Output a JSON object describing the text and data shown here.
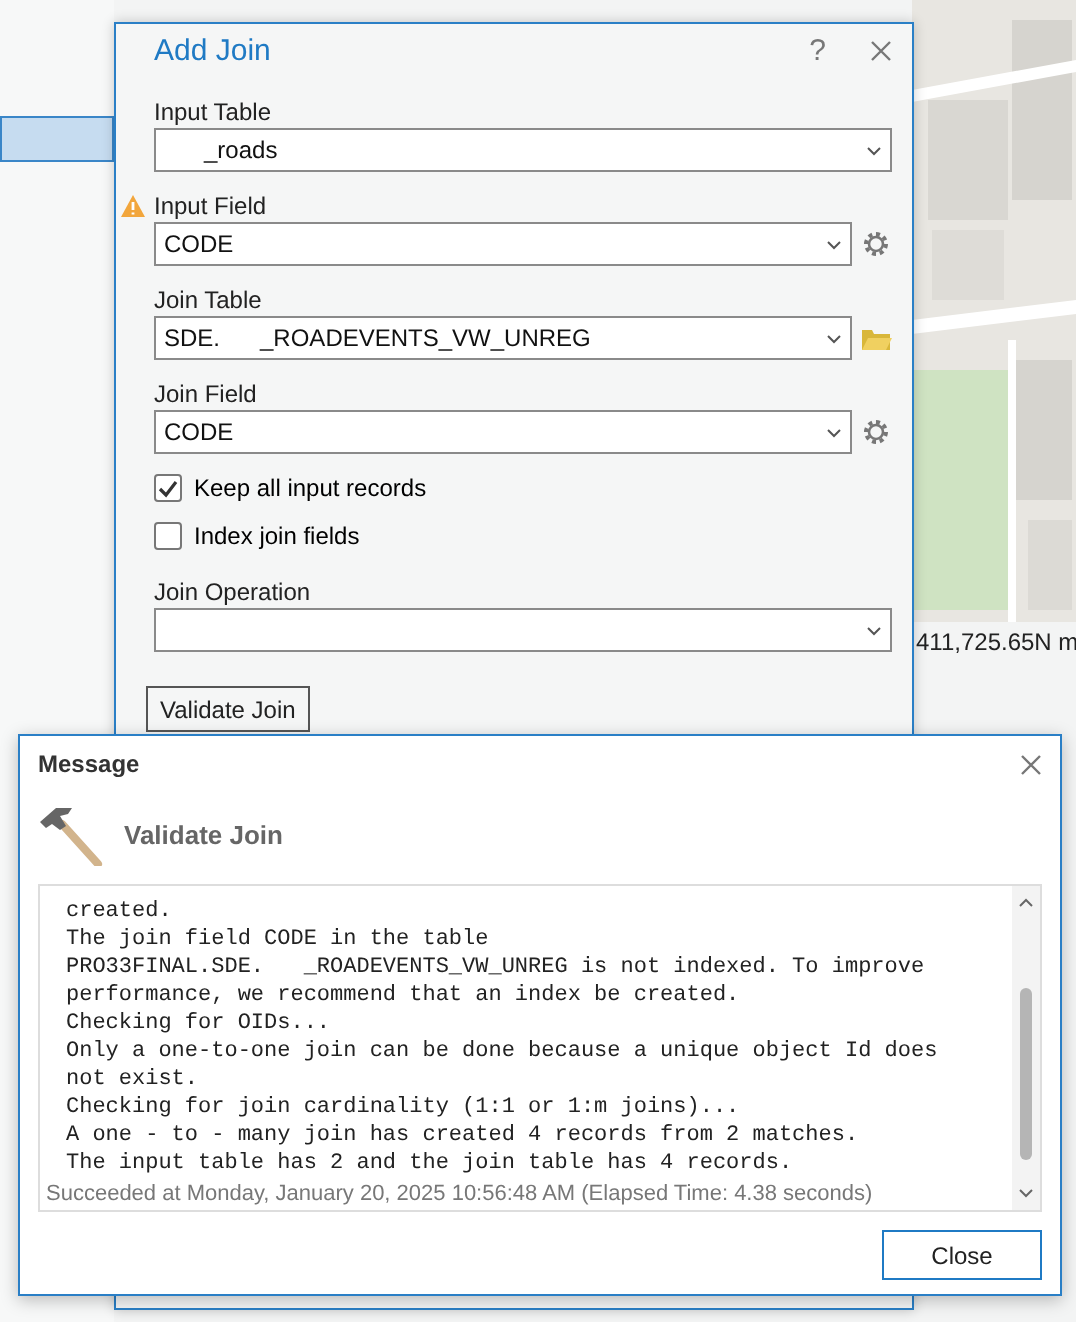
{
  "side_panel": {
    "rows": [
      {
        "selected": true
      }
    ]
  },
  "coordinates": "411,725.65N m",
  "add_join": {
    "title": "Add Join",
    "help": "?",
    "fields": [
      {
        "label": "Input Table",
        "value": "      _roads",
        "warning": false,
        "kind": "plain"
      },
      {
        "label": "Input Field",
        "value": "CODE",
        "warning": true,
        "kind": "gear"
      },
      {
        "label": "Join Table",
        "value": "SDE.      _ROADEVENTS_VW_UNREG",
        "warning": false,
        "kind": "folder"
      },
      {
        "label": "Join Field",
        "value": "CODE",
        "warning": false,
        "kind": "gear"
      }
    ],
    "checkboxes": [
      {
        "label": "Keep all input records",
        "checked": true
      },
      {
        "label": "Index join fields",
        "checked": false
      }
    ],
    "operation": {
      "label": "Join Operation"
    },
    "validate_button": "Validate Join"
  },
  "message": {
    "title": "Message",
    "tool_name": "Validate Join",
    "lines": [
      "created.",
      "The join field CODE in the table",
      "PRO33FINAL.SDE.   _ROADEVENTS_VW_UNREG is not indexed. To improve",
      "performance, we recommend that an index be created.",
      "Checking for OIDs...",
      "Only a one-to-one join can be done because a unique object Id does",
      "not exist.",
      "Checking for join cardinality (1:1 or 1:m joins)...",
      "A one - to - many join has created 4 records from 2 matches.",
      "The input table has 2 and the join table has 4 records."
    ],
    "status": "Succeeded at Monday, January 20, 2025 10:56:48 AM (Elapsed Time: 4.38 seconds)",
    "close_button": "Close"
  }
}
